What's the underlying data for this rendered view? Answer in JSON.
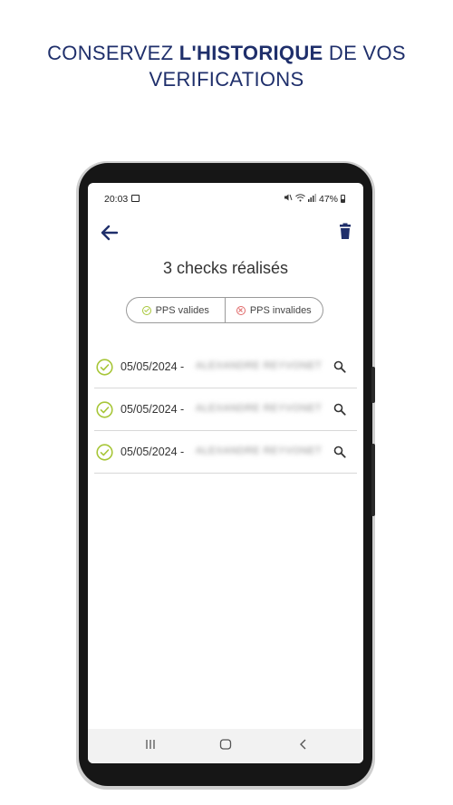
{
  "headline": {
    "part1": "CONSERVEZ ",
    "bold": "L'HISTORIQUE",
    "part2": " DE VOS",
    "line2": "VERIFICATIONS",
    "color": "#1f2f6b"
  },
  "statusbar": {
    "time": "20:03",
    "battery": "47%"
  },
  "toolbar": {
    "back_icon": "arrow-left-icon",
    "trash_icon": "trash-icon",
    "accent": "#1f2f6b"
  },
  "summary": {
    "title": "3 checks réalisés"
  },
  "filters": {
    "valid_label": "PPS valides",
    "invalid_label": "PPS invalides",
    "valid_color": "#a7c638",
    "invalid_color": "#e06a6a"
  },
  "checks": [
    {
      "date": "05/05/2024 -",
      "name": "ALEXANDRE REYVONET"
    },
    {
      "date": "05/05/2024 -",
      "name": "ALEXANDRE REYVONET"
    },
    {
      "date": "05/05/2024 -",
      "name": "ALEXANDRE REYVONET"
    }
  ],
  "navbar": {
    "recent_icon": "recent-apps-icon",
    "home_icon": "home-icon",
    "back_icon": "nav-back-icon"
  }
}
